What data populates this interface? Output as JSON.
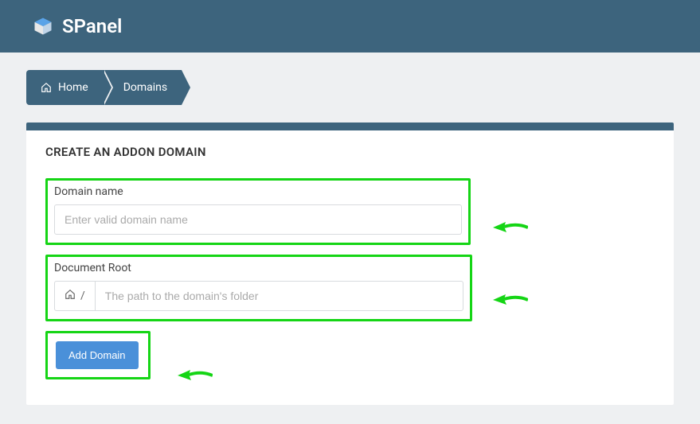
{
  "header": {
    "brand": "SPanel"
  },
  "breadcrumb": {
    "home": "Home",
    "current": "Domains"
  },
  "panel": {
    "title": "CREATE AN ADDON DOMAIN",
    "domain": {
      "label": "Domain name",
      "placeholder": "Enter valid domain name"
    },
    "docroot": {
      "label": "Document Root",
      "prefix": "/",
      "placeholder": "The path to the domain's folder"
    },
    "button": "Add Domain"
  }
}
